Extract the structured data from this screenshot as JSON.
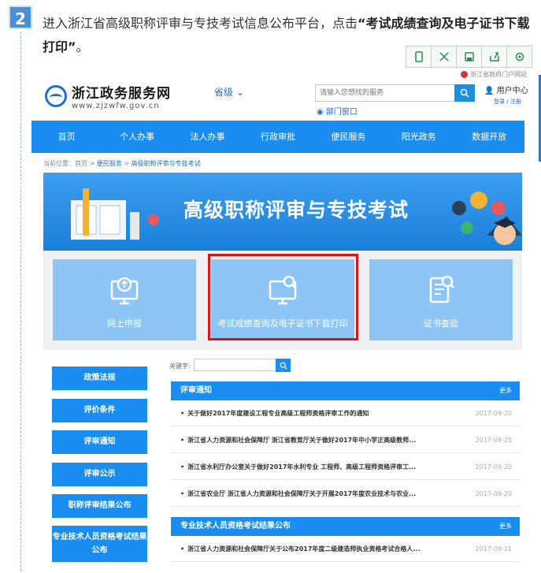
{
  "step": "2",
  "instruction": {
    "prefix": "进入浙江省高级职称评审与专技考试信息公布平台，点击",
    "bold": "“考试成绩查询及电子证书下载打印”",
    "suffix": "。"
  },
  "toolbar": [
    "copy-icon",
    "expand-icon",
    "save-icon",
    "share-icon",
    "settings-icon"
  ],
  "portal_note": "浙江省政府门户网站",
  "logo": {
    "title": "浙江政务服务网",
    "url": "www.zjzwfw.gov.cn"
  },
  "province": "省级",
  "search": {
    "placeholder": "请输入您想找的服务"
  },
  "user": {
    "label": "用户中心",
    "login": "登录 / 注册"
  },
  "dept_link": "部门窗口",
  "nav": [
    "首页",
    "个人办事",
    "法人办事",
    "行政审批",
    "便民服务",
    "阳光政务",
    "数据开放"
  ],
  "breadcrumb": {
    "prefix": "当前位置：",
    "home": "首页",
    "sep1": " > ",
    "service": "便民服务",
    "sep2": " > ",
    "current": "高级职称评审与专技考试"
  },
  "banner": {
    "title": "高级职称评审与专技考试"
  },
  "quick_links": [
    "网上申报",
    "考试成绩查询及电子证书下载打印",
    "证书查验"
  ],
  "sidebar": [
    "政策法规",
    "评价条件",
    "评审通知",
    "评审公示",
    "职称评审结果公布",
    "专业技术人员资格考试结果公布"
  ],
  "keyword": {
    "label": "关键字:"
  },
  "sections": [
    {
      "title": "评审通知",
      "more": "更多",
      "items": [
        {
          "text": "关于做好2017年度建设工程专业高级工程师资格评审工作的通知",
          "date": "2017-09-20"
        },
        {
          "text": "浙江省人力资源和社会保障厅 浙江省教育厅关于做好2017年中小学正高级教师...",
          "date": "2017-09-20"
        },
        {
          "text": "浙江省水利厅办公室关于做好2017年水利专业 工程师、高级工程师资格评审工...",
          "date": "2017-09-20"
        },
        {
          "text": "浙江省农业厅 浙江省人力资源和社会保障厅关于开展2017年度农业技术与农业...",
          "date": "2017-09-20"
        }
      ]
    },
    {
      "title": "专业技术人员资格考试结果公布",
      "more": "更多",
      "items": [
        {
          "text": "浙江省人力资源和社会保障厅关于公布2017年度二级建造师执业资格考试合格人...",
          "date": "2017-09-21"
        }
      ]
    }
  ]
}
